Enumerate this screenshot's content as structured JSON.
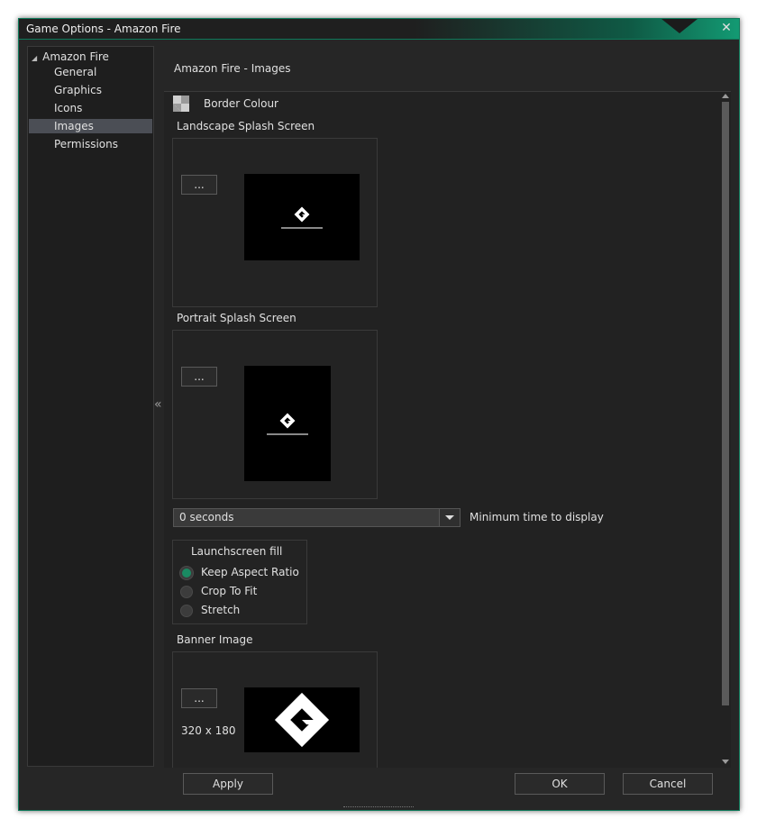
{
  "window": {
    "title": "Game Options - Amazon Fire",
    "close_glyph": "✕"
  },
  "sidebar": {
    "root": {
      "label": "Amazon Fire",
      "arrow": "◢"
    },
    "items": [
      {
        "label": "General",
        "selected": false
      },
      {
        "label": "Graphics",
        "selected": false
      },
      {
        "label": "Icons",
        "selected": false
      },
      {
        "label": "Images",
        "selected": true
      },
      {
        "label": "Permissions",
        "selected": false
      }
    ],
    "collapse_glyph": "«"
  },
  "page": {
    "header": "Amazon Fire - Images",
    "border_colour_label": "Border Colour",
    "landscape": {
      "label": "Landscape Splash Screen",
      "browse_label": "..."
    },
    "portrait": {
      "label": "Portrait Splash Screen",
      "browse_label": "..."
    },
    "min_time": {
      "value": "0 seconds",
      "label": "Minimum time to display"
    },
    "launchscreen_fill": {
      "title": "Launchscreen fill",
      "options": [
        {
          "label": "Keep Aspect Ratio",
          "selected": true
        },
        {
          "label": "Crop To Fit",
          "selected": false
        },
        {
          "label": "Stretch",
          "selected": false
        }
      ]
    },
    "banner": {
      "label": "Banner Image",
      "browse_label": "...",
      "size": "320 x 180"
    }
  },
  "buttons": {
    "apply": "Apply",
    "ok": "OK",
    "cancel": "Cancel"
  },
  "colors": {
    "accent": "#139a73",
    "radio_selected": "#1a8a62",
    "selected_row": "#4b4e55"
  }
}
